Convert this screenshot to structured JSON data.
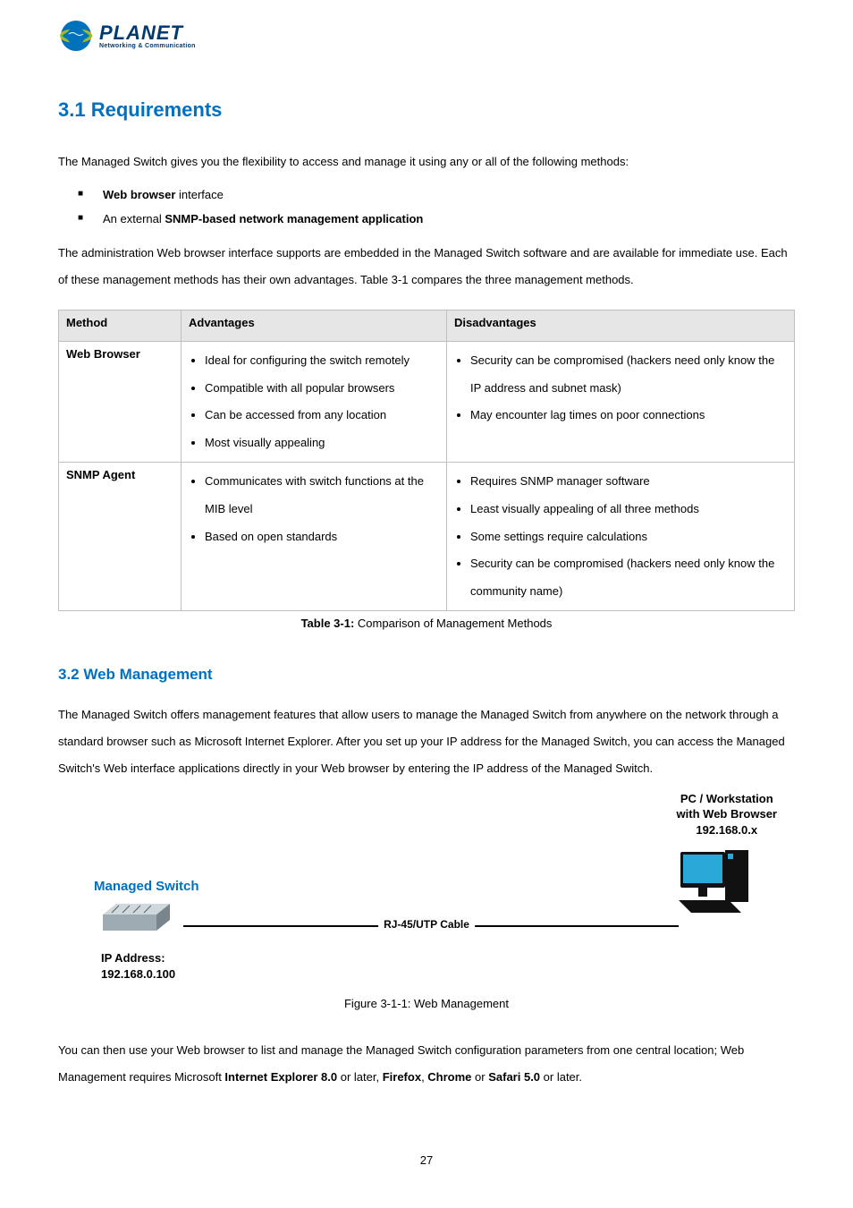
{
  "logo": {
    "brand": "PLANET",
    "tagline": "Networking & Communication"
  },
  "section_title": "3.1 Requirements",
  "intro_para": "The Managed Switch gives you the flexibility to access and manage it using any or all of the following methods:",
  "methods": {
    "item1_bold": "Web browser",
    "item1_text": " interface",
    "item2_prefix": "An external ",
    "item2_bold": "SNMP-based network management application"
  },
  "para2": "The administration Web browser interface supports are embedded in the Managed Switch software and are available for immediate use. Each of these management methods has their own advantages. Table 3-1 compares the three management methods.",
  "table": {
    "headers": [
      "Method",
      "Advantages",
      "Disadvantages"
    ],
    "rows": [
      {
        "method": "Web Browser",
        "advantages": [
          "Ideal for configuring the switch remotely",
          "Compatible with all popular browsers",
          "Can be accessed from any location",
          "Most visually appealing"
        ],
        "disadvantages": [
          "Security can be compromised (hackers need only know the IP address and subnet mask)",
          "May encounter lag times on poor connections"
        ]
      },
      {
        "method": "SNMP Agent",
        "advantages": [
          "Communicates with switch functions at the MIB level",
          "Based on open standards"
        ],
        "disadvantages": [
          "Requires SNMP manager software",
          "Least visually appealing of all three methods",
          "Some settings require calculations",
          "Security can be compromised (hackers need only know the community name)"
        ]
      }
    ]
  },
  "table_caption_bold": "Table 3-1:",
  "table_caption_text": " Comparison of Management Methods",
  "sub_heading": "3.2 Web Management",
  "web_para": "The Managed Switch offers management features that allow users to manage the Managed Switch from anywhere on the network through a standard browser such as Microsoft Internet Explorer. After you set up your IP address for the Managed Switch, you can access the Managed Switch's Web interface applications directly in your Web browser by entering the IP address of the Managed Switch.",
  "diagram": {
    "pc_title": "PC / Workstation",
    "pc_sub": "with Web Browser",
    "pc_ip": "192.168.0.x",
    "switch_label": "Managed Switch",
    "cable_text": "RJ-45/UTP Cable",
    "ip_title": "IP Address:",
    "ip_value": "192.168.0.100"
  },
  "fig_caption_bold": "Figure 3-1-1:",
  "fig_caption_text": " Web Management",
  "final_para_1": "You can then use your Web browser to list and manage the Managed Switch configuration parameters from one central location; Web Management requires Microsoft ",
  "final_ie": "Internet Explorer 8.0",
  "final_mid1": " or later, ",
  "final_ff": "Firefox",
  "final_mid2": ", ",
  "final_chrome": "Chrome",
  "final_mid3": " or ",
  "final_safari": "Safari 5.0",
  "final_end": " or later.",
  "page_number": "27"
}
